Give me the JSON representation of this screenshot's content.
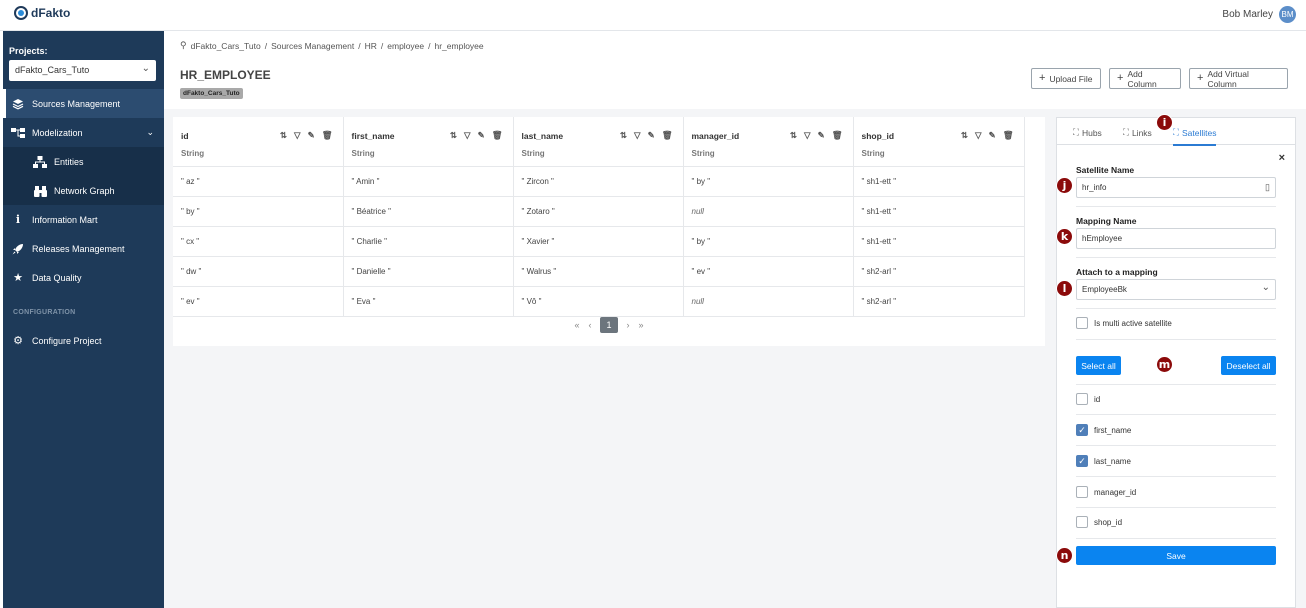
{
  "app": {
    "logo_text": "dFakto",
    "user_name": "Bob Marley",
    "user_initials": "BM"
  },
  "sidebar": {
    "projects_label": "Projects:",
    "project_value": "dFakto_Cars_Tuto",
    "items": [
      {
        "label": "Sources Management",
        "icon": "layers-icon"
      },
      {
        "label": "Modelization",
        "icon": "hierarchy-icon"
      },
      {
        "label": "Entities",
        "icon": "sitemap-icon"
      },
      {
        "label": "Network Graph",
        "icon": "binoculars-icon"
      },
      {
        "label": "Information Mart",
        "icon": "info-icon"
      },
      {
        "label": "Releases Management",
        "icon": "rocket-icon"
      },
      {
        "label": "Data Quality",
        "icon": "star-icon"
      }
    ],
    "section_label": "CONFIGURATION",
    "configure_label": "Configure Project"
  },
  "header": {
    "breadcrumb": [
      "dFakto_Cars_Tuto",
      "Sources Management",
      "HR",
      "employee",
      "hr_employee"
    ],
    "title": "HR_EMPLOYEE",
    "tag": "dFakto_Cars_Tuto",
    "buttons": {
      "upload": "Upload File",
      "add_column": "Add Column",
      "add_virtual": "Add Virtual Column"
    }
  },
  "table": {
    "columns": [
      {
        "name": "id",
        "type": "String"
      },
      {
        "name": "first_name",
        "type": "String"
      },
      {
        "name": "last_name",
        "type": "String"
      },
      {
        "name": "manager_id",
        "type": "String"
      },
      {
        "name": "shop_id",
        "type": "String"
      }
    ],
    "rows": [
      [
        "\" az \"",
        "\" Amin \"",
        "\" Zircon \"",
        "\" by \"",
        "\" sh1-ett \""
      ],
      [
        "\" by \"",
        "\" Béatrice \"",
        "\" Zotaro \"",
        "null",
        "\" sh1-ett \""
      ],
      [
        "\" cx \"",
        "\" Charlie \"",
        "\" Xavier \"",
        "\" by \"",
        "\" sh1-ett \""
      ],
      [
        "\" dw \"",
        "\" Danielle \"",
        "\" Walrus \"",
        "\" ev \"",
        "\" sh2-arl \""
      ],
      [
        "\" ev \"",
        "\" Eva \"",
        "\" Vô \"",
        "null",
        "\" sh2-arl \""
      ]
    ],
    "pager": {
      "first": "«",
      "prev": "‹",
      "page": "1",
      "next": "›",
      "last": "»"
    }
  },
  "panel": {
    "tabs": {
      "hubs": "Hubs",
      "links": "Links",
      "satellites": "Satellites"
    },
    "close": "×",
    "satellite_name_label": "Satellite Name",
    "satellite_name_value": "hr_info",
    "mapping_name_label": "Mapping Name",
    "mapping_name_value": "hEmployee",
    "attach_label": "Attach to a mapping",
    "attach_value": "EmployeeBk",
    "multi_active_label": "Is multi active satellite",
    "select_all": "Select all",
    "deselect_all": "Deselect all",
    "fields": [
      {
        "label": "id",
        "checked": false
      },
      {
        "label": "first_name",
        "checked": true
      },
      {
        "label": "last_name",
        "checked": true
      },
      {
        "label": "manager_id",
        "checked": false
      },
      {
        "label": "shop_id",
        "checked": false
      }
    ],
    "save": "Save"
  },
  "markers": {
    "i": "i",
    "j": "j",
    "k": "k",
    "l": "l",
    "m": "m",
    "n": "n"
  },
  "colors": {
    "sidebar": "#1e3a59",
    "primary": "#0a84f0",
    "marker": "#8b0a0a"
  }
}
